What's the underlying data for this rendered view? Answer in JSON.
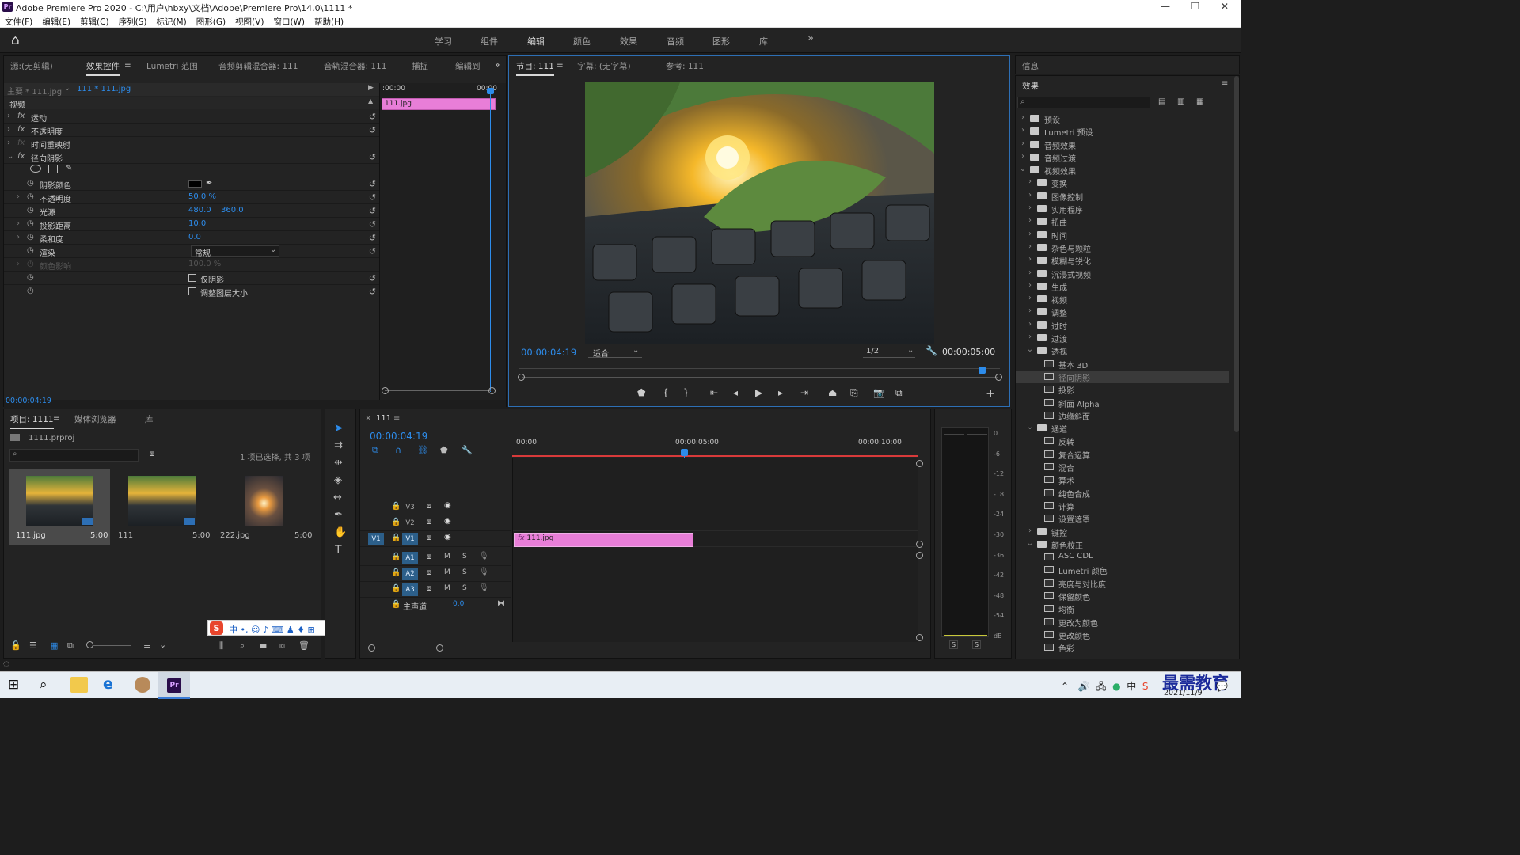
{
  "titlebar": {
    "logo": "Pr",
    "title": "Adobe Premiere Pro 2020 - C:\\用户\\hbxy\\文档\\Adobe\\Premiere Pro\\14.0\\1111 *",
    "min": "—",
    "max": "❐",
    "close": "✕"
  },
  "menu": [
    "文件(F)",
    "编辑(E)",
    "剪辑(C)",
    "序列(S)",
    "标记(M)",
    "图形(G)",
    "视图(V)",
    "窗口(W)",
    "帮助(H)"
  ],
  "workspaces": [
    "学习",
    "组件",
    "编辑",
    "颜色",
    "效果",
    "音频",
    "图形",
    "库"
  ],
  "workspaces_more": "»",
  "home_icon": "⌂",
  "effect_controls": {
    "tabs": [
      "源:(无剪辑)",
      "效果控件",
      "Lumetri 范围",
      "音频剪辑混合器: 111",
      "音轨混合器: 111",
      "捕捉",
      "编辑到"
    ],
    "more": "»",
    "master": "主要 * 111.jpg",
    "clip": "111 * 111.jpg",
    "mini_time_start": ":00:00",
    "mini_time_end": "00:00",
    "mini_clip": "111.jpg",
    "section": "视频",
    "effects": [
      {
        "name": "运动"
      },
      {
        "name": "不透明度"
      },
      {
        "name": "时间重映射"
      },
      {
        "name": "径向阴影"
      }
    ],
    "params": [
      {
        "name": "阴影颜色",
        "value": ""
      },
      {
        "name": "不透明度",
        "value": "50.0 %"
      },
      {
        "name": "光源",
        "value": "480.0",
        "value2": "360.0"
      },
      {
        "name": "投影距离",
        "value": "10.0"
      },
      {
        "name": "柔和度",
        "value": "0.0"
      },
      {
        "name": "渲染",
        "value": "常规"
      },
      {
        "name": "颜色影响",
        "value": "100.0 %"
      },
      {
        "name": "",
        "value": "仅阴影"
      },
      {
        "name": "",
        "value": "调整图层大小"
      }
    ],
    "timecode": "00:00:04:19"
  },
  "program": {
    "tabs": [
      "节目: 111",
      "字幕: (无字幕)",
      "参考: 111"
    ],
    "timecode": "00:00:04:19",
    "fit": "适合",
    "resolution": "1/2",
    "duration": "00:00:05:00",
    "playhead_fraction": 0.97,
    "add": "+"
  },
  "info": {
    "title": "信息"
  },
  "effects_panel": {
    "title": "效果",
    "search_placeholder": "",
    "tree": [
      {
        "label": "预设",
        "level": 0,
        "open": false,
        "type": "folder"
      },
      {
        "label": "Lumetri 预设",
        "level": 0,
        "open": false,
        "type": "folder"
      },
      {
        "label": "音频效果",
        "level": 0,
        "open": false,
        "type": "folder"
      },
      {
        "label": "音频过渡",
        "level": 0,
        "open": false,
        "type": "folder"
      },
      {
        "label": "视频效果",
        "level": 0,
        "open": true,
        "type": "folder"
      },
      {
        "label": "变换",
        "level": 1,
        "open": false,
        "type": "folder"
      },
      {
        "label": "图像控制",
        "level": 1,
        "open": false,
        "type": "folder"
      },
      {
        "label": "实用程序",
        "level": 1,
        "open": false,
        "type": "folder"
      },
      {
        "label": "扭曲",
        "level": 1,
        "open": false,
        "type": "folder"
      },
      {
        "label": "时间",
        "level": 1,
        "open": false,
        "type": "folder"
      },
      {
        "label": "杂色与颗粒",
        "level": 1,
        "open": false,
        "type": "folder"
      },
      {
        "label": "模糊与锐化",
        "level": 1,
        "open": false,
        "type": "folder"
      },
      {
        "label": "沉浸式视频",
        "level": 1,
        "open": false,
        "type": "folder"
      },
      {
        "label": "生成",
        "level": 1,
        "open": false,
        "type": "folder"
      },
      {
        "label": "视频",
        "level": 1,
        "open": false,
        "type": "folder"
      },
      {
        "label": "调整",
        "level": 1,
        "open": false,
        "type": "folder"
      },
      {
        "label": "过时",
        "level": 1,
        "open": false,
        "type": "folder"
      },
      {
        "label": "过渡",
        "level": 1,
        "open": false,
        "type": "folder"
      },
      {
        "label": "透视",
        "level": 1,
        "open": true,
        "type": "folder"
      },
      {
        "label": "基本 3D",
        "level": 2,
        "type": "fx"
      },
      {
        "label": "径向阴影",
        "level": 2,
        "type": "fx",
        "selected": true
      },
      {
        "label": "投影",
        "level": 2,
        "type": "fx"
      },
      {
        "label": "斜面 Alpha",
        "level": 2,
        "type": "fx"
      },
      {
        "label": "边缘斜面",
        "level": 2,
        "type": "fx"
      },
      {
        "label": "通道",
        "level": 1,
        "open": true,
        "type": "folder"
      },
      {
        "label": "反转",
        "level": 2,
        "type": "fx"
      },
      {
        "label": "复合运算",
        "level": 2,
        "type": "fx"
      },
      {
        "label": "混合",
        "level": 2,
        "type": "fx"
      },
      {
        "label": "算术",
        "level": 2,
        "type": "fx"
      },
      {
        "label": "纯色合成",
        "level": 2,
        "type": "fx"
      },
      {
        "label": "计算",
        "level": 2,
        "type": "fx"
      },
      {
        "label": "设置遮罩",
        "level": 2,
        "type": "fx"
      },
      {
        "label": "键控",
        "level": 1,
        "open": false,
        "type": "folder"
      },
      {
        "label": "颜色校正",
        "level": 1,
        "open": true,
        "type": "folder"
      },
      {
        "label": "ASC CDL",
        "level": 2,
        "type": "fx"
      },
      {
        "label": "Lumetri 颜色",
        "level": 2,
        "type": "fx"
      },
      {
        "label": "亮度与对比度",
        "level": 2,
        "type": "fx"
      },
      {
        "label": "保留颜色",
        "level": 2,
        "type": "fx"
      },
      {
        "label": "均衡",
        "level": 2,
        "type": "fx"
      },
      {
        "label": "更改为颜色",
        "level": 2,
        "type": "fx"
      },
      {
        "label": "更改颜色",
        "level": 2,
        "type": "fx"
      },
      {
        "label": "色彩",
        "level": 2,
        "type": "fx"
      }
    ]
  },
  "project": {
    "tabs": [
      "项目: 1111",
      "媒体浏览器",
      "库"
    ],
    "file": "1111.prproj",
    "status": "1 项已选择, 共 3 项",
    "items": [
      {
        "name": "111.jpg",
        "duration": "5:00",
        "selected": true
      },
      {
        "name": "111",
        "duration": "5:00"
      },
      {
        "name": "222.jpg",
        "duration": "5:00"
      }
    ]
  },
  "timeline": {
    "tab": "111",
    "timecode": "00:00:04:19",
    "ruler": [
      ":00:00",
      "00:00:05:00",
      "00:00:10:00"
    ],
    "tracks": [
      {
        "name": "V3"
      },
      {
        "name": "V2"
      },
      {
        "name": "V1",
        "src": "V1"
      },
      {
        "name": "A1"
      },
      {
        "name": "A2"
      },
      {
        "name": "A3"
      }
    ],
    "master": "主声道",
    "master_value": "0.0",
    "clip": "111.jpg"
  },
  "meter": {
    "labels": [
      "0",
      "-6",
      "-12",
      "-18",
      "-24",
      "-30",
      "-36",
      "-42",
      "-48",
      "-54",
      "dB"
    ],
    "solo": [
      "S",
      "S"
    ]
  },
  "ime": {
    "label": "中 •, ☺ ♪ ⌨ ♟ ♦ ⊞"
  },
  "taskbar": {
    "date": "2021/11/9",
    "watermark": "最需教育",
    "start": "⊞",
    "search": "⌕"
  }
}
